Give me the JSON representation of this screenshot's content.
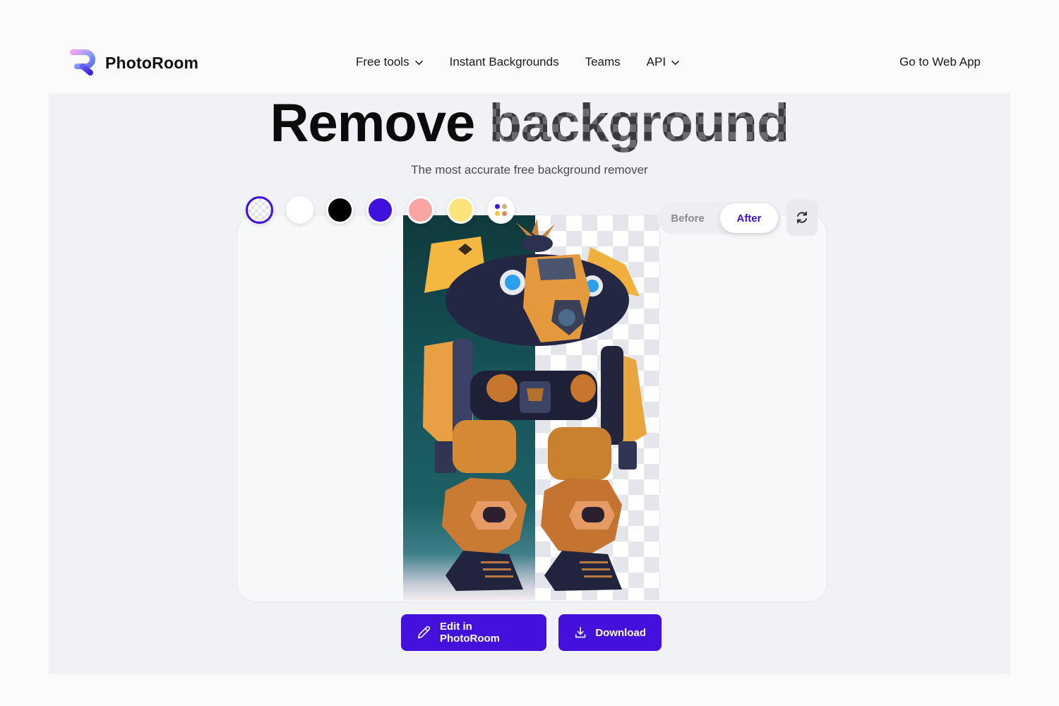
{
  "header": {
    "brand": "PhotoRoom",
    "nav": [
      {
        "label": "Free tools",
        "has_dropdown": true
      },
      {
        "label": "Instant Backgrounds",
        "has_dropdown": false
      },
      {
        "label": "Teams",
        "has_dropdown": false
      },
      {
        "label": "API",
        "has_dropdown": true
      }
    ],
    "cta": "Go to Web App"
  },
  "hero": {
    "title_word1": "Remove",
    "title_word2": "background",
    "subtitle": "The most accurate free background remover"
  },
  "editor": {
    "background_swatches": [
      {
        "name": "transparent",
        "color": "transparent",
        "selected": true
      },
      {
        "name": "white",
        "color": "#ffffff",
        "selected": false
      },
      {
        "name": "black",
        "color": "#000000",
        "selected": false
      },
      {
        "name": "purple",
        "color": "#4010dc",
        "selected": false
      },
      {
        "name": "pink",
        "color": "#f9a5a3",
        "selected": false
      },
      {
        "name": "yellow",
        "color": "#fde37b",
        "selected": false
      },
      {
        "name": "more-colors",
        "color": "multi",
        "selected": false,
        "dots": [
          "#3b16d8",
          "#c4b48a",
          "#f8c93b",
          "#e28a5e"
        ]
      }
    ],
    "view_toggle": {
      "before_label": "Before",
      "after_label": "After",
      "selected": "After"
    },
    "swap_icon": "refresh-icon",
    "image_description": "Orange and navy mech robot; left half with teal background (before), right half on transparency checkerboard (after)"
  },
  "actions": {
    "edit_label": "Edit in PhotoRoom",
    "edit_icon": "pencil-icon",
    "download_label": "Download",
    "download_icon": "download-icon"
  },
  "colors": {
    "accent": "#4310dc",
    "page_bg": "#f1f2f6",
    "header_bg": "#fbfbfc"
  }
}
